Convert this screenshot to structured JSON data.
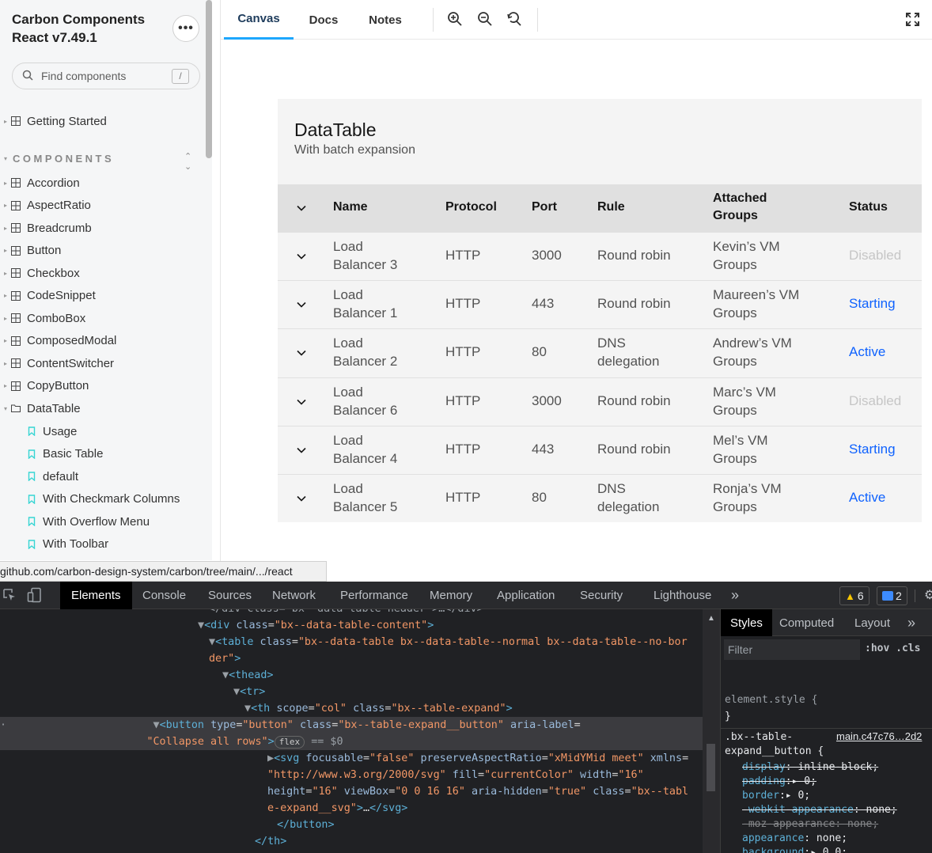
{
  "sidebar": {
    "brand_line1": "Carbon Components",
    "brand_line2": "React v7.49.1",
    "search_placeholder": "Find components",
    "search_shortcut": "/",
    "getting_started": "Getting Started",
    "section_label": "COMPONENTS",
    "components": [
      "Accordion",
      "AspectRatio",
      "Breadcrumb",
      "Button",
      "Checkbox",
      "CodeSnippet",
      "ComboBox",
      "ComposedModal",
      "ContentSwitcher",
      "CopyButton",
      "DataTable"
    ],
    "stories": [
      "Usage",
      "Basic Table",
      "default",
      "With Checkmark Columns",
      "With Overflow Menu",
      "With Toolbar"
    ]
  },
  "toolbar": {
    "tabs": [
      "Canvas",
      "Docs",
      "Notes"
    ]
  },
  "datatable": {
    "title": "DataTable",
    "description": "With batch expansion",
    "headers": [
      "Name",
      "Protocol",
      "Port",
      "Rule",
      "Attached",
      "Groups",
      "Status"
    ],
    "rows": [
      {
        "name1": "Load",
        "name2": "Balancer 3",
        "protocol": "HTTP",
        "port": "3000",
        "rule1": "Round robin",
        "rule2": "",
        "group1": "Kevin’s VM",
        "group2": "Groups",
        "status": "Disabled",
        "status_color": "#c6c6c6"
      },
      {
        "name1": "Load",
        "name2": "Balancer 1",
        "protocol": "HTTP",
        "port": "443",
        "rule1": "Round robin",
        "rule2": "",
        "group1": "Maureen’s VM",
        "group2": "Groups",
        "status": "Starting",
        "status_color": "#0f62fe"
      },
      {
        "name1": "Load",
        "name2": "Balancer 2",
        "protocol": "HTTP",
        "port": "80",
        "rule1": "DNS",
        "rule2": "delegation",
        "group1": "Andrew’s VM",
        "group2": "Groups",
        "status": "Active",
        "status_color": "#0f62fe"
      },
      {
        "name1": "Load",
        "name2": "Balancer 6",
        "protocol": "HTTP",
        "port": "3000",
        "rule1": "Round robin",
        "rule2": "",
        "group1": "Marc’s VM",
        "group2": "Groups",
        "status": "Disabled",
        "status_color": "#c6c6c6"
      },
      {
        "name1": "Load",
        "name2": "Balancer 4",
        "protocol": "HTTP",
        "port": "443",
        "rule1": "Round robin",
        "rule2": "",
        "group1": "Mel’s VM",
        "group2": "Groups",
        "status": "Starting",
        "status_color": "#0f62fe"
      },
      {
        "name1": "Load",
        "name2": "Balancer 5",
        "protocol": "HTTP",
        "port": "80",
        "rule1": "DNS",
        "rule2": "delegation",
        "group1": "Ronja’s VM",
        "group2": "Groups",
        "status": "Active",
        "status_color": "#0f62fe"
      }
    ]
  },
  "status_url": "github.com/carbon-design-system/carbon/tree/main/.../react",
  "devtools": {
    "tabs": [
      "Elements",
      "Console",
      "Sources",
      "Network",
      "Performance",
      "Memory",
      "Application",
      "Security",
      "Lighthouse"
    ],
    "more": "»",
    "warnings": "6",
    "messages": "2",
    "styles_tabs": [
      "Styles",
      "Computed",
      "Layout"
    ],
    "filter_placeholder": "Filter",
    "hov_cls": ":hov  .cls",
    "element_style": "element.style {",
    "close_brace": "}",
    "selector_line1": ".bx--table-",
    "selector_line2": "expand__button {",
    "source_link": "main.c47c76…2d2",
    "flex_badge": "flex",
    "dollar0": "== $0"
  }
}
